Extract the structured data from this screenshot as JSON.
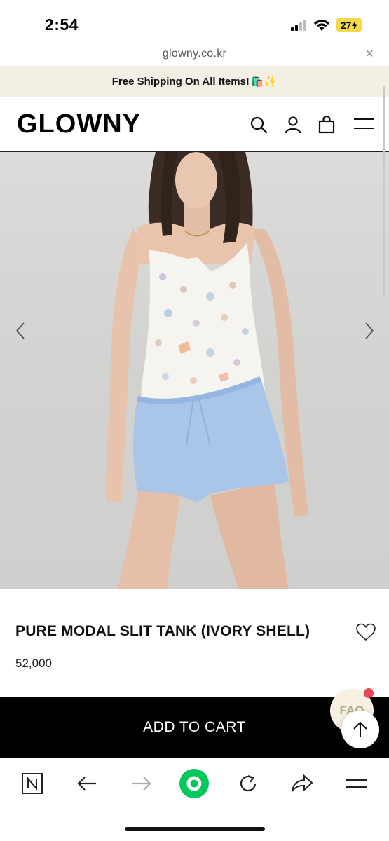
{
  "status_bar": {
    "time": "2:54",
    "battery": "27",
    "icons": [
      "signal-icon",
      "wifi-icon",
      "battery-icon"
    ]
  },
  "browser": {
    "url": "glowny.co.kr",
    "close_icon": "×"
  },
  "promo": {
    "text": "Free Shipping On All Items!",
    "emoji": "🛍️✨"
  },
  "header": {
    "logo": "GLOWNY",
    "icons": [
      "search-icon",
      "account-icon",
      "bag-icon",
      "menu-icon"
    ]
  },
  "product": {
    "title": "PURE MODAL SLIT TANK (IVORY SHELL)",
    "price": "52,000"
  },
  "actions": {
    "add_to_cart": "ADD TO CART",
    "faq": "FAQ"
  },
  "bottom_bar": {
    "icons": [
      "naver-icon",
      "back-icon",
      "forward-icon",
      "green-home-icon",
      "refresh-icon",
      "share-icon",
      "menu-icon"
    ]
  },
  "colors": {
    "promo_bg": "#f4efe4",
    "cta_bg": "#000000",
    "faq_bg": "#f6f1e2",
    "notify_dot": "#e8475a",
    "naver_green": "#03c75a",
    "battery": "#f5d94a"
  }
}
